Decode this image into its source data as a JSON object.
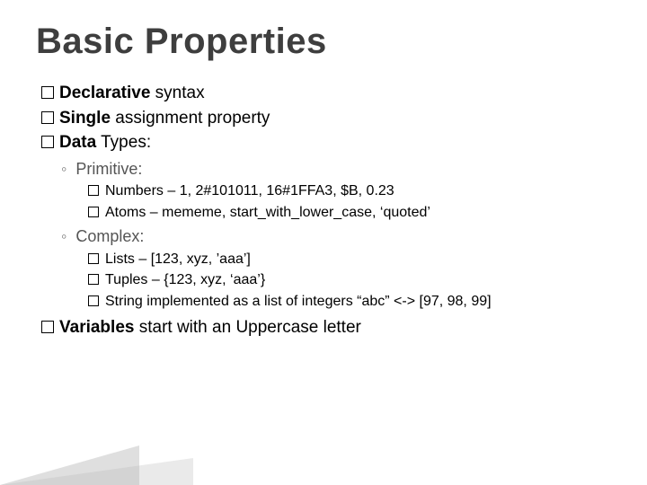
{
  "title": "Basic Properties",
  "b1": {
    "lead": "Declarative",
    "rest": " syntax"
  },
  "b2": {
    "lead": "Single",
    "rest": " assignment property"
  },
  "b3": {
    "lead": "Data",
    "rest": " Types:"
  },
  "prim": {
    "label": "Primitive:",
    "numbers": "Numbers – 1, 2#101011, 16#1FFA3, $B, 0.23",
    "atoms": "Atoms – mememe, start_with_lower_case, ‘quoted’"
  },
  "complex": {
    "label": "Complex:",
    "lists": "Lists – [123, xyz, ’aaa’]",
    "tuples": "Tuples – {123, xyz, ‘aaa’}",
    "string": "String implemented as a list of integers “abc” <-> [97, 98, 99]"
  },
  "b4": {
    "lead": "Variables",
    "rest": " start with an Uppercase letter"
  }
}
